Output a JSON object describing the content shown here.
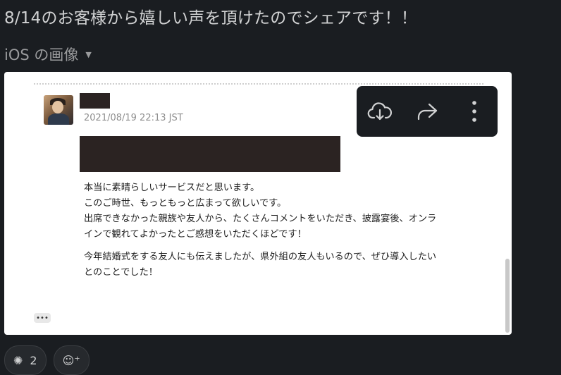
{
  "message": {
    "text": "8/14のお客様から嬉しい声を頂けたのでシェアです！！"
  },
  "file": {
    "label": "iOS の画像",
    "caret": "▼"
  },
  "card": {
    "timestamp": "2021/08/19 22:13 JST",
    "lines": [
      "本当に素晴らしいサービスだと思います。",
      "このご時世、もっともっと広まって欲しいです。",
      "出席できなかった親族や友人から、たくさんコメントをいただき、披露宴後、オンラ",
      "インで観れてよかったとご感想をいただくほどです！"
    ],
    "lines2": [
      "今年結婚式をする友人にも伝えましたが、県外組の友人もいるので、ぜひ導入したい",
      "とのことでした！"
    ],
    "more": "•••"
  },
  "toolbar": {
    "icons": [
      "cloud-download-icon",
      "share-icon",
      "more-vertical-icon"
    ]
  },
  "reactions": {
    "first_count": "2"
  }
}
